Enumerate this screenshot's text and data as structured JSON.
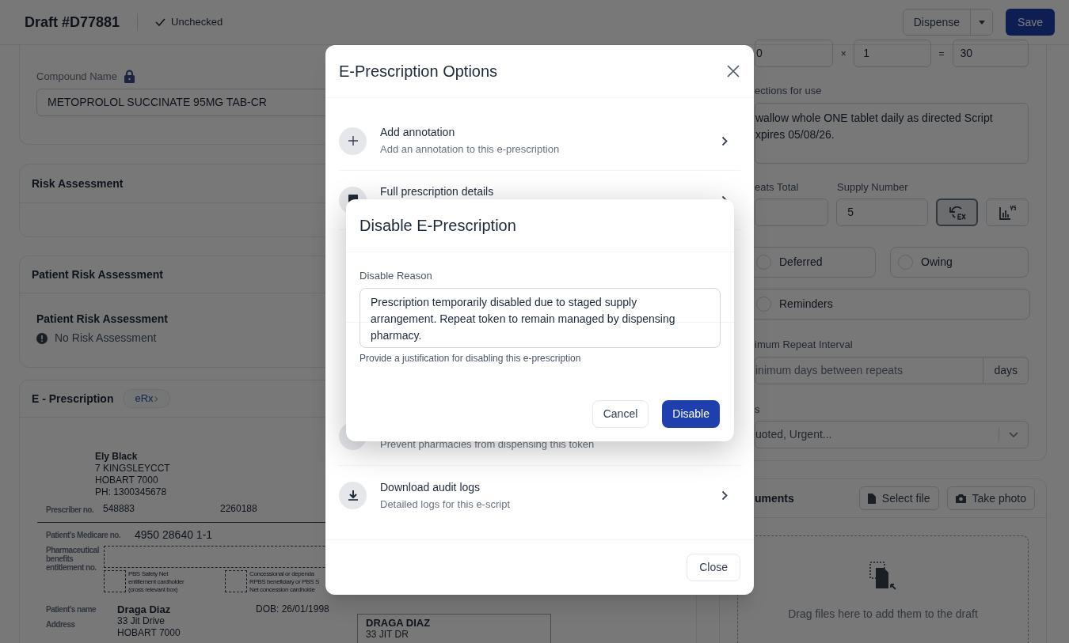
{
  "header": {
    "title": "Draft #D77881",
    "status": "Unchecked",
    "dispense_button": "Dispense",
    "save_button": "Save"
  },
  "compound": {
    "label": "Compound Name",
    "locked": true,
    "value": "METOPROLOL SUCCINATE 95MG TAB-CR"
  },
  "risk_assessment": {
    "title": "Risk Assessment"
  },
  "patient_risk": {
    "title": "Patient Risk Assessment",
    "heading": "Patient Risk Assessment",
    "note": "No Risk Assessment"
  },
  "eprescription": {
    "title": "E - Prescription",
    "badge": "eRx",
    "form": {
      "prescriber_name": "Ely Black",
      "prescriber_address": [
        "7 KINGSLEYCCT",
        "HOBART 7000",
        "PH: 1300345678"
      ],
      "prescriber_no_label": "Prescriber no.",
      "prescriber_no": "548883",
      "other_no": "2260188",
      "medicare_label": "Patient's Medicare no.",
      "medicare_no": "4950 28640 1-1",
      "entitlement_label": [
        "Pharmaceutical",
        "benefits",
        "entitlement no."
      ],
      "checkboxes": [
        {
          "lines": [
            "PBS Safety Net",
            "entitlement cardholder",
            "(cross relevant box)"
          ],
          "checked": false
        },
        {
          "lines": [
            "Concessional or dependa",
            "RPBS beneficiary or PBS S",
            "Net concession cardholde"
          ],
          "checked": false
        }
      ],
      "patient_name_label": "Patient's name",
      "address_label": "Address",
      "patient_name": "Draga Diaz",
      "patient_address": [
        "33 Jit Drive",
        "HOBART 7000"
      ],
      "dob": "DOB: 26/01/1998",
      "label_box": [
        "DRAGA DIAZ",
        "33 JIT DR"
      ]
    }
  },
  "right": {
    "quantity": [
      "0",
      "1",
      "30"
    ],
    "operators": [
      "×",
      "="
    ],
    "directions": {
      "label": "ections for use",
      "value": "wallow whole ONE tablet daily as directed Script\nxpires 05/08/26."
    },
    "repeats_label": "eats Total",
    "supply_label": "Supply Number",
    "supply_value": "5",
    "tools": [
      {
        "kind": "undo",
        "selected": true
      },
      {
        "kind": "chart",
        "selected": false
      }
    ],
    "options": [
      {
        "label": "Deferred",
        "checked": false
      },
      {
        "label": "Owing",
        "checked": false
      },
      {
        "label": "Reminders",
        "checked": false
      }
    ],
    "min_interval": {
      "label": "imum Repeat Interval",
      "placeholder": "inimum days between repeats",
      "suffix": "days"
    },
    "tags": {
      "label": "s",
      "placeholder": "uoted, Urgent..."
    }
  },
  "documents": {
    "title": "uments",
    "buttons": [
      {
        "kind": "file",
        "label": "Select file"
      },
      {
        "kind": "camera",
        "label": "Take photo"
      }
    ],
    "dropzone": "Drag files here to add them to the draft"
  },
  "options_modal": {
    "title": "E-Prescription Options",
    "items": [
      {
        "kind": "add",
        "title": "Add annotation",
        "description": "Add an annotation to this e-prescription"
      },
      {
        "kind": "details",
        "title": "Full prescription details"
      },
      {
        "kind": "disable",
        "description": "Prevent pharmacies from dispensing this token"
      },
      {
        "kind": "download",
        "title": "Download audit logs",
        "description": "Detailed logs for this e-script"
      }
    ],
    "close_button": "Close"
  },
  "disable_dialog": {
    "title": "Disable E-Prescription",
    "label": "Disable Reason",
    "value": "Prescription temporarily disabled due to staged supply arrangement. Repeat token to remain managed by dispensing pharmacy.",
    "help": "Provide a justification for disabling this e-prescription",
    "cancel": "Cancel",
    "confirm": "Disable"
  }
}
